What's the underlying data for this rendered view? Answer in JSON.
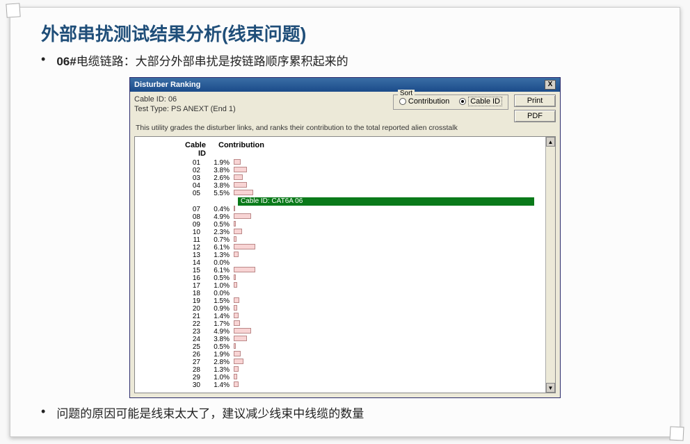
{
  "slide": {
    "title": "外部串扰测试结果分析(线束问题)",
    "bullet1_bold": "06#",
    "bullet1_rest": "电缆链路：大部分外部串扰是按链路顺序累积起来的",
    "bullet2": "问题的原因可能是线束太大了，建议减少线束中线缆的数量"
  },
  "window": {
    "title": "Disturber Ranking",
    "close": "X",
    "cable_id_label": "Cable ID: 06",
    "test_type_label": "Test Type: PS ANEXT (End 1)",
    "sort_legend": "Sort",
    "sort_contribution": "Contribution",
    "sort_cableid": "Cable ID",
    "btn_print": "Print",
    "btn_pdf": "PDF",
    "description": "This utility grades the disturber links, and ranks their contribution to the total reported alien crosstalk",
    "col_id": "Cable ID",
    "col_contrib": "Contribution",
    "highlight_label": "Cable ID: CAT6A 06",
    "scroll_up": "▲",
    "scroll_down": "▼"
  },
  "chart_data": {
    "type": "bar",
    "title": "Disturber Ranking — Contribution by Cable ID",
    "xlabel": "Contribution (%)",
    "ylabel": "Cable ID",
    "xlim": [
      0,
      10
    ],
    "highlight_after_index": 4,
    "highlight_label": "Cable ID: CAT6A 06",
    "rows": [
      {
        "id": "01",
        "pct": 1.9
      },
      {
        "id": "02",
        "pct": 3.8
      },
      {
        "id": "03",
        "pct": 2.6
      },
      {
        "id": "04",
        "pct": 3.8
      },
      {
        "id": "05",
        "pct": 5.5
      },
      {
        "id": "07",
        "pct": 0.4
      },
      {
        "id": "08",
        "pct": 4.9
      },
      {
        "id": "09",
        "pct": 0.5
      },
      {
        "id": "10",
        "pct": 2.3
      },
      {
        "id": "11",
        "pct": 0.7
      },
      {
        "id": "12",
        "pct": 6.1
      },
      {
        "id": "13",
        "pct": 1.3
      },
      {
        "id": "14",
        "pct": 0.0
      },
      {
        "id": "15",
        "pct": 6.1
      },
      {
        "id": "16",
        "pct": 0.5
      },
      {
        "id": "17",
        "pct": 1.0
      },
      {
        "id": "18",
        "pct": 0.0
      },
      {
        "id": "19",
        "pct": 1.5
      },
      {
        "id": "20",
        "pct": 0.9
      },
      {
        "id": "21",
        "pct": 1.4
      },
      {
        "id": "22",
        "pct": 1.7
      },
      {
        "id": "23",
        "pct": 4.9
      },
      {
        "id": "24",
        "pct": 3.8
      },
      {
        "id": "25",
        "pct": 0.5
      },
      {
        "id": "26",
        "pct": 1.9
      },
      {
        "id": "27",
        "pct": 2.8
      },
      {
        "id": "28",
        "pct": 1.3
      },
      {
        "id": "29",
        "pct": 1.0
      },
      {
        "id": "30",
        "pct": 1.4
      }
    ]
  }
}
